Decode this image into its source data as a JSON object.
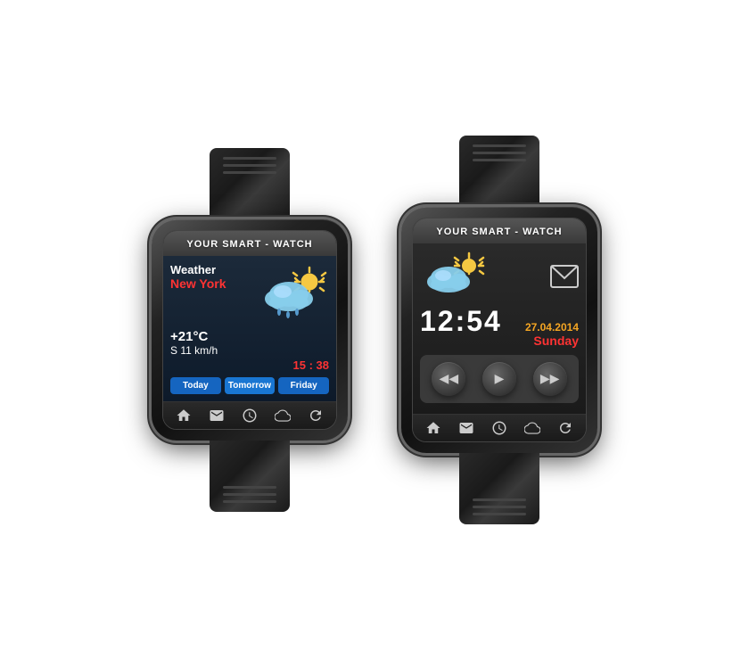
{
  "page": {
    "background": "#ffffff"
  },
  "watch1": {
    "brand": "YOUR SMART - WATCH",
    "weather_label": "Weather",
    "city": "New York",
    "temperature": "+21°C",
    "wind": "S 11 km/h",
    "time": "15 : 38",
    "buttons": [
      "Today",
      "Tomorrow",
      "Friday"
    ],
    "nav_icons": [
      "home",
      "mail",
      "clock",
      "cloud",
      "refresh"
    ]
  },
  "watch2": {
    "brand": "YOUR SMART - WATCH",
    "time": "12:54",
    "date": "27.04.2014",
    "day": "Sunday",
    "nav_icons": [
      "home",
      "mail",
      "clock",
      "cloud",
      "refresh"
    ],
    "media_controls": [
      "rewind",
      "play",
      "fast-forward"
    ]
  }
}
